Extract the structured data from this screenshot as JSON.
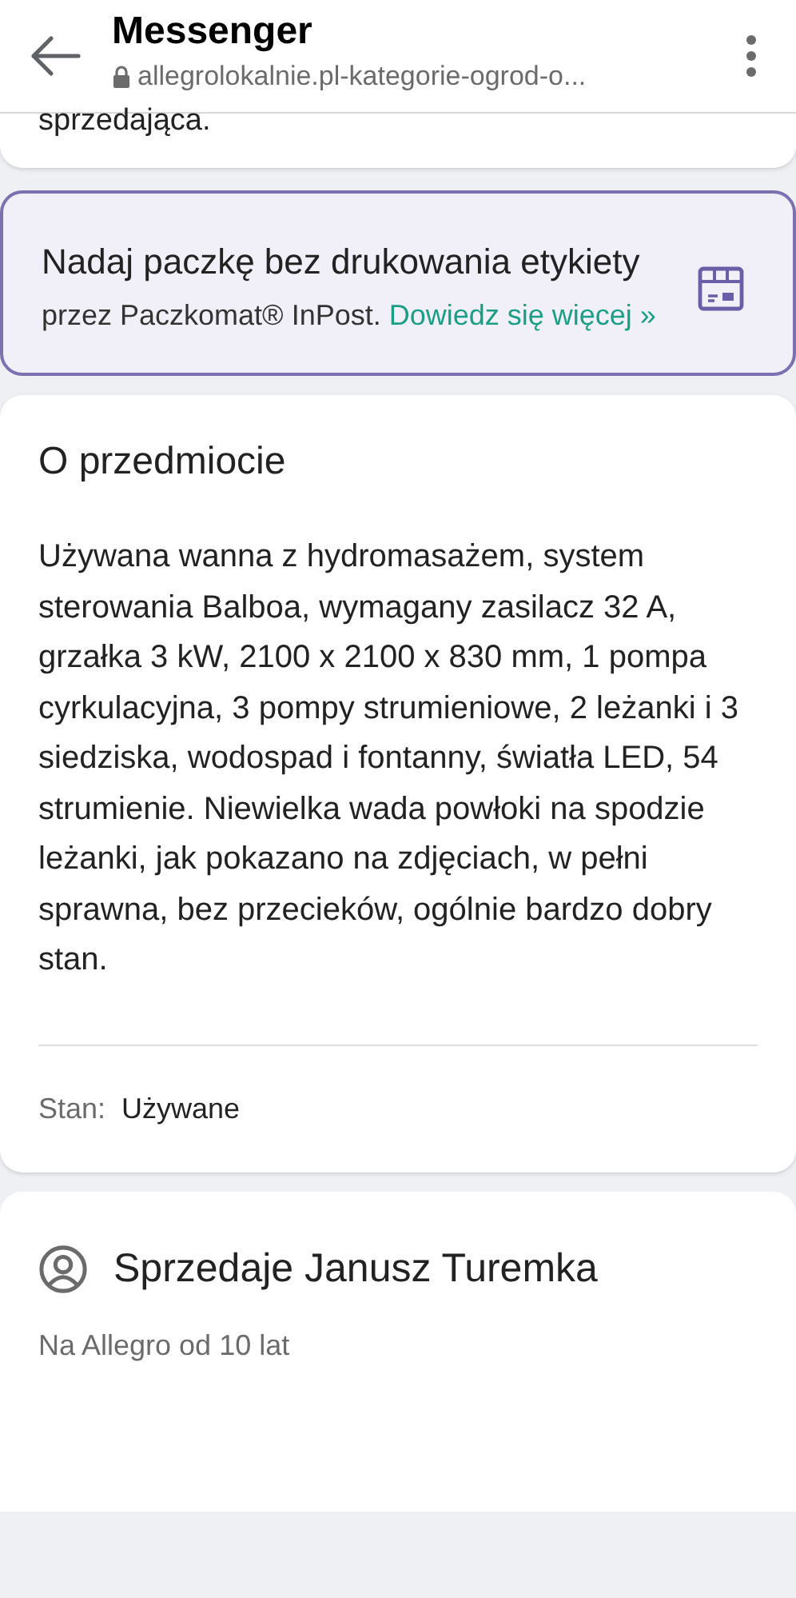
{
  "browser_bar": {
    "title": "Messenger",
    "url": "allegrolokalnie.pl-kategorie-ogrod-o..."
  },
  "previous_card": {
    "text_tail": "sprzedająca."
  },
  "shipping_banner": {
    "title": "Nadaj paczkę bez drukowania etykiety",
    "text": "przez Paczkomat® InPost.",
    "link": "Dowiedz się więcej »"
  },
  "item_card": {
    "title": "O przedmiocie",
    "description": "Używana wanna z hydromasażem, system sterowania Balboa, wymagany zasilacz 32 A, grzałka 3 kW, 2100 x 2100 x 830 mm, 1 pompa cyrkulacyjna, 3 pompy strumieniowe, 2 leżanki i 3 siedziska, wodospad i fontanny, światła LED, 54 strumienie. Niewielka wada powłoki na spodzie leżanki, jak pokazano na zdjęciach, w pełni sprawna, bez przecieków, ogólnie bardzo dobry stan.",
    "condition_label": "Stan:",
    "condition_value": "Używane"
  },
  "seller_card": {
    "title": "Sprzedaje Janusz Turemka",
    "since": "Na Allegro od 10 lat"
  }
}
